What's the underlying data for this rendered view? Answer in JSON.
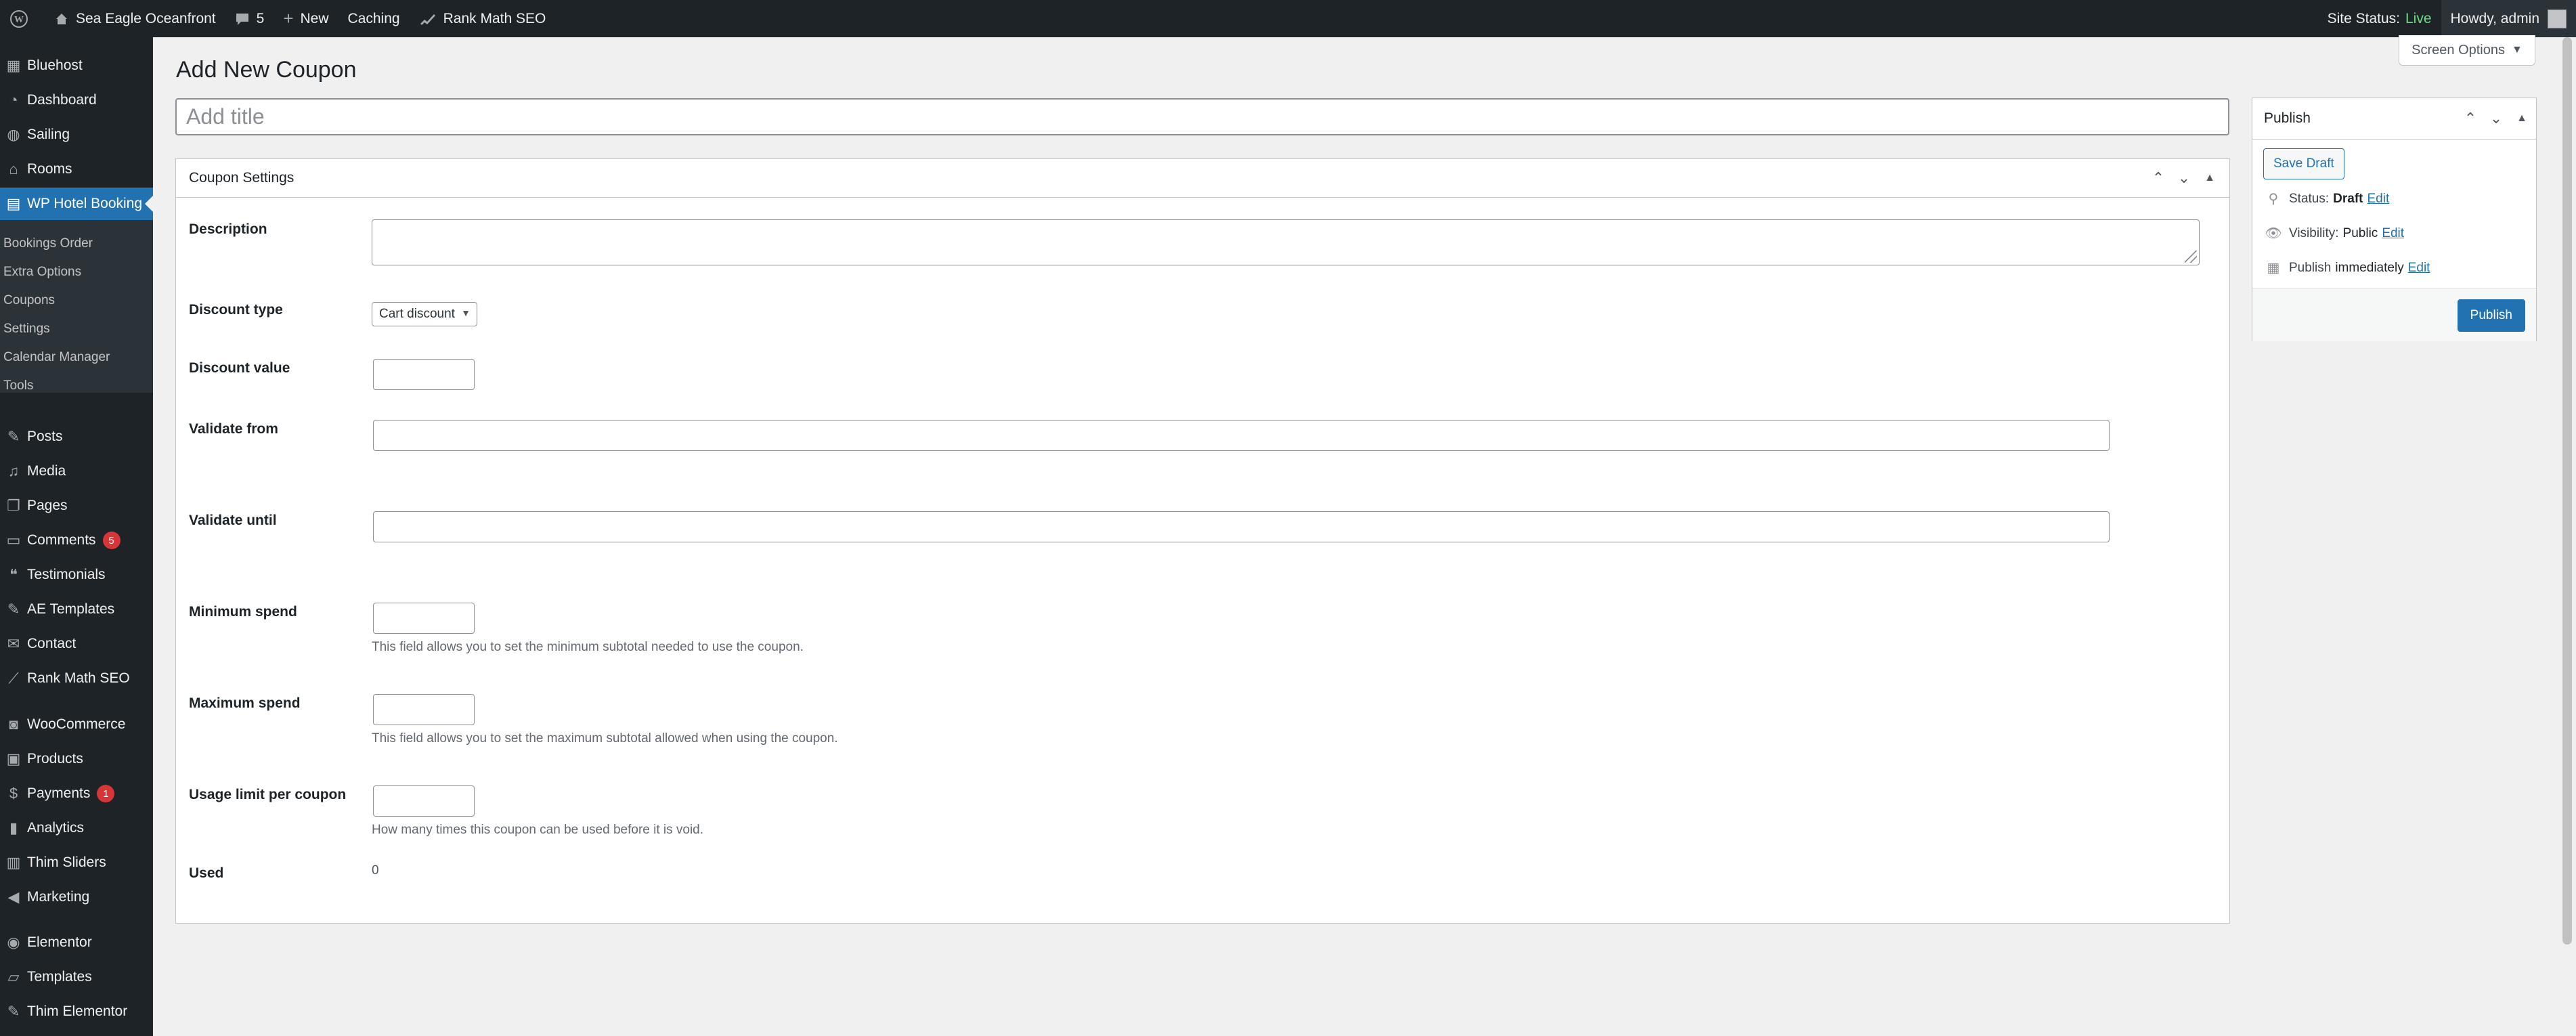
{
  "adminbar": {
    "site_name": "Sea Eagle Oceanfront",
    "comments_count": "5",
    "new_label": "New",
    "caching_label": "Caching",
    "rankmath_label": "Rank Math SEO",
    "site_status_label": "Site Status:",
    "site_status_value": "Live",
    "howdy": "Howdy, admin"
  },
  "sidebar": {
    "bluehost": "Bluehost",
    "dashboard": "Dashboard",
    "sailing": "Sailing",
    "rooms": "Rooms",
    "wp_hotel_booking": "WP Hotel Booking",
    "submenu": {
      "bookings_order": "Bookings Order",
      "extra_options": "Extra Options",
      "coupons": "Coupons",
      "settings": "Settings",
      "calendar_manager": "Calendar Manager",
      "tools": "Tools"
    },
    "posts": "Posts",
    "media": "Media",
    "pages": "Pages",
    "comments": "Comments",
    "comments_badge": "5",
    "testimonials": "Testimonials",
    "ae_templates": "AE Templates",
    "contact": "Contact",
    "rank_math_seo": "Rank Math SEO",
    "woocommerce": "WooCommerce",
    "products": "Products",
    "payments": "Payments",
    "payments_badge": "1",
    "analytics": "Analytics",
    "thim_sliders": "Thim Sliders",
    "marketing": "Marketing",
    "elementor": "Elementor",
    "templates": "Templates",
    "thim_elementor": "Thim Elementor"
  },
  "page": {
    "title": "Add New Coupon",
    "screen_options": "Screen Options",
    "title_placeholder": "Add title"
  },
  "coupon_settings": {
    "heading": "Coupon Settings",
    "description_label": "Description",
    "discount_type_label": "Discount type",
    "discount_type_value": "Cart discount",
    "discount_value_label": "Discount value",
    "validate_from_label": "Validate from",
    "validate_until_label": "Validate until",
    "minimum_spend_label": "Minimum spend",
    "minimum_spend_help": "This field allows you to set the minimum subtotal needed to use the coupon.",
    "maximum_spend_label": "Maximum spend",
    "maximum_spend_help": "This field allows you to set the maximum subtotal allowed when using the coupon.",
    "usage_limit_label": "Usage limit per coupon",
    "usage_limit_help": "How many times this coupon can be used before it is void.",
    "used_label": "Used",
    "used_value": "0"
  },
  "publish": {
    "heading": "Publish",
    "save_draft": "Save Draft",
    "status_label": "Status:",
    "status_value": "Draft",
    "visibility_label": "Visibility:",
    "visibility_value": "Public",
    "publish_label": "Publish",
    "publish_value": "immediately",
    "edit_label": "Edit",
    "publish_button": "Publish"
  },
  "colors": {
    "admin_bar": "#1d2327",
    "accent": "#2271b1",
    "badge": "#d63638",
    "live": "#68de7c"
  }
}
